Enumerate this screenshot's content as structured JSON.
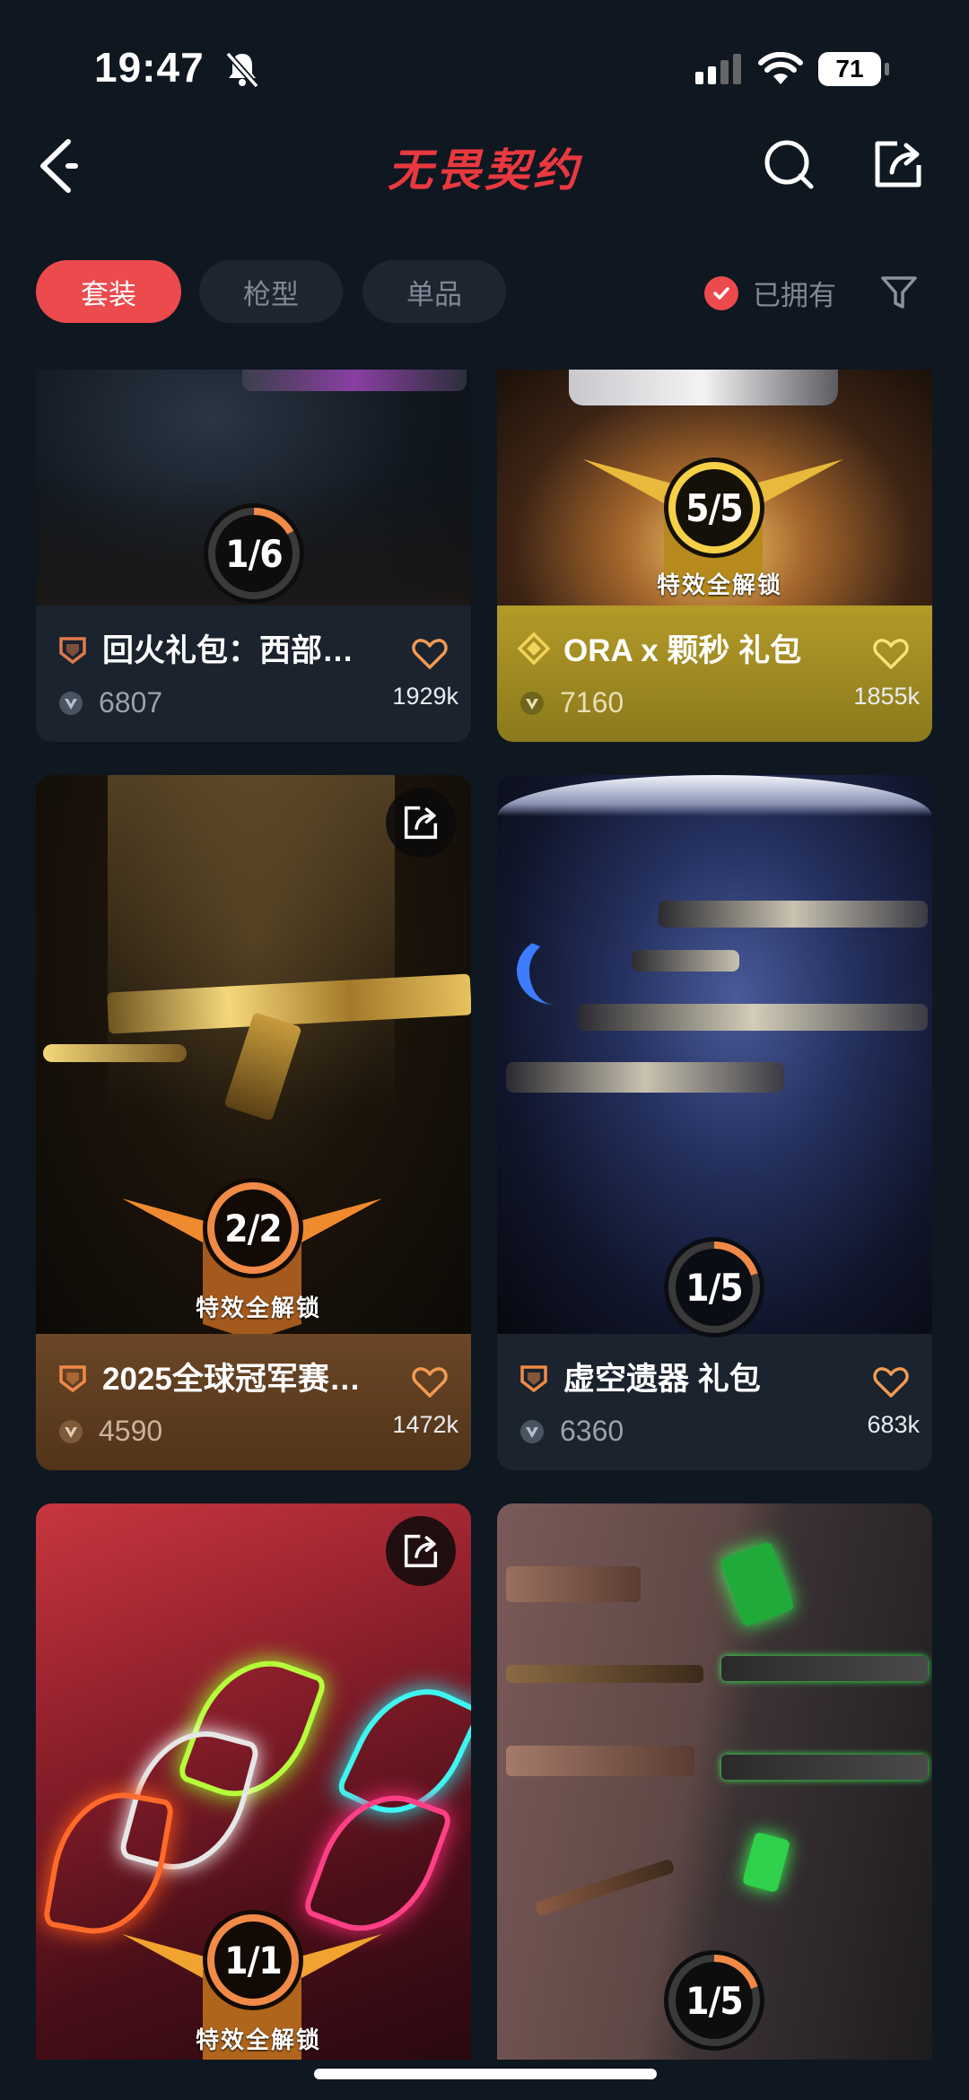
{
  "status": {
    "time": "19:47",
    "battery": "71"
  },
  "header": {
    "title": "无畏契约"
  },
  "filters": {
    "chips": [
      {
        "label": "套装",
        "active": true
      },
      {
        "label": "枪型",
        "active": false
      },
      {
        "label": "单品",
        "active": false
      }
    ],
    "owned_label": "已拥有"
  },
  "cards": [
    {
      "name": "回火礼包：西部…",
      "price": "6807",
      "count": "1929k",
      "progress": "1/6",
      "progress_value": 0.1667,
      "unlock": "",
      "style": "dark"
    },
    {
      "name": "ORA x 颗秒 礼包",
      "price": "7160",
      "count": "1855k",
      "progress": "5/5",
      "progress_value": 1.0,
      "unlock": "特效全解锁",
      "style": "gold"
    },
    {
      "name": "2025全球冠军赛…",
      "price": "4590",
      "count": "1472k",
      "progress": "2/2",
      "progress_value": 1.0,
      "unlock": "特效全解锁",
      "style": "bronze"
    },
    {
      "name": "虚空遗器 礼包",
      "price": "6360",
      "count": "683k",
      "progress": "1/5",
      "progress_value": 0.2,
      "unlock": "",
      "style": "dark"
    },
    {
      "name": "",
      "price": "",
      "count": "",
      "progress": "1/1",
      "progress_value": 1.0,
      "unlock": "特效全解锁",
      "style": "dark"
    },
    {
      "name": "",
      "price": "",
      "count": "",
      "progress": "1/5",
      "progress_value": 0.2,
      "unlock": "",
      "style": "dark"
    }
  ],
  "colors": {
    "accent": "#ec4a4d",
    "background": "#0f1721",
    "gold": "#b39a28",
    "bronze": "#6b4627"
  }
}
